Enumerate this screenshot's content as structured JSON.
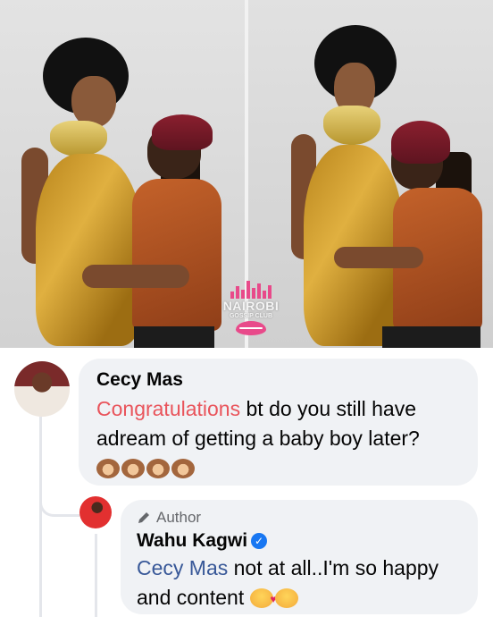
{
  "watermark": {
    "title": "NAIROBI",
    "subtitle": "GOSSIP CLUB"
  },
  "comment": {
    "author": "Cecy Mas",
    "highlight": "Congratulations",
    "text_line1": " bt do you still have",
    "text_line2": "adream of getting a baby boy later?",
    "emoji_count": 4,
    "emoji_name": "see-no-evil-monkey"
  },
  "reply": {
    "badge": "Author",
    "author": "Wahu Kagwi",
    "verified": true,
    "mention": "Cecy Mas",
    "text_line1": " not at all..I'm so happy",
    "text_line2": "and content",
    "emojis": [
      "smiling-face-with-hearts",
      "hugging-face"
    ]
  },
  "colors": {
    "highlight": "#e9545b",
    "mention": "#385898",
    "verified": "#1877f2",
    "bubble": "#f0f2f5",
    "watermark_accent": "#e84a8a"
  }
}
